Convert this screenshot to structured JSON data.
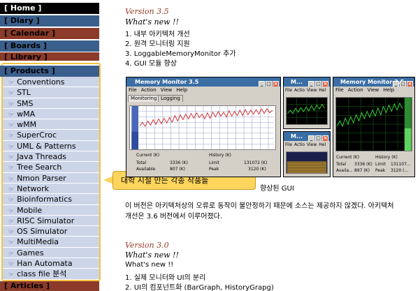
{
  "nav": {
    "home": "[ Home ]",
    "diary": "[ Diary ]",
    "calendar": "[ Calendar ]",
    "boards": "[ Boards ]",
    "library": "[ Library ]",
    "products": "[ Products ]",
    "articles": "[ Articles ]",
    "bullet": "☞",
    "product_items": [
      "Conventions",
      "STL",
      "SMS",
      "wMA",
      "wMM",
      "SuperCroc",
      "UML & Patterns",
      "Java Threads",
      "Tree Search",
      "Nmon Parser",
      "Network",
      "Bioinformatics",
      "Mobile",
      "RISC Simulator",
      "OS Simulator",
      "MultiMedia",
      "Games",
      "Han Automata",
      "class file 분석"
    ],
    "colors": {
      "blue": "#3b5f8c",
      "red": "#8c3a2a",
      "item_bg": "#ccd5e8",
      "highlight": "#f5c140"
    }
  },
  "tooltip": {
    "text": "대학 시절 만든 각종 작품들"
  },
  "v35": {
    "title": "Version 3.5",
    "whats_new": "What's new !!",
    "items": [
      "1. 내부 아키텍처 개선",
      "2. 원격 모니터링 지원",
      "3. LoggableMemoryMonitor 추가",
      "4. GUI 모듈 향상"
    ],
    "caption": "향상된 GUI",
    "desc_1": "이 버전은 아키텍처상의 오류로 동작이 불안정하기 때문에 소스는 제공하지 않겠다. 아키텍처",
    "desc_2": "개선은 3.6 버전에서 이루어졌다."
  },
  "v30": {
    "title": "Version 3.0",
    "whats_new": "What's new !!",
    "whats_new_plain": "What's new !!",
    "items": [
      "1. 실제 모니터와 UI의 분리",
      "2. UI의 컴포넌트화 (BarGraph, HistoryGrapg)"
    ]
  },
  "screens": {
    "main_title": "Memory Monitor 3.5",
    "right_title": "Memory Monitor 3.5",
    "mid_title": "M...",
    "menu_main": [
      "File",
      "Action",
      "View",
      "Help"
    ],
    "menu_mid": [
      "File",
      "Actio",
      "View",
      "Hel"
    ],
    "tab_monitoring": "Monitoring",
    "tab_logging": "Logging",
    "stats_main": {
      "current_h": "Current (K)",
      "history_h": "History (K)",
      "total_l": "Total",
      "total_v": "3336 (K)",
      "limit_l": "Limit",
      "limit_v": "131072 (K)",
      "avail_l": "Available",
      "avail_v": "807 (K)",
      "peak_l": "Peak",
      "peak_v": "3120 (K)"
    },
    "stats_right": {
      "current_h": "Current (K)",
      "history_h": "History (K)",
      "total_l": "Total",
      "total_v": "3336 (K)",
      "limit_l": "Limit",
      "limit_v": "131107...",
      "avail_l": "Availa...",
      "avail_v": "897 (K)",
      "peak_l": "Peak",
      "peak_v": "3120 (..."
    }
  }
}
